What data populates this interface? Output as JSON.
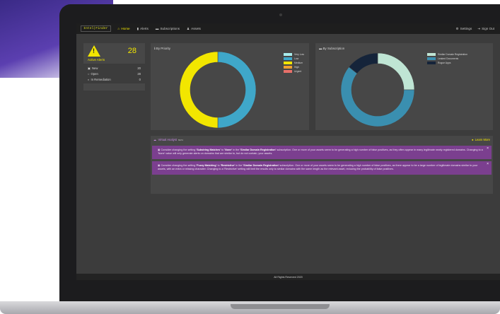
{
  "navbar": {
    "logo": "Intel|Finder",
    "items": [
      {
        "label": "Home",
        "icon": "home-icon",
        "glyph": "⌂",
        "active": true
      },
      {
        "label": "Alerts",
        "icon": "file-icon",
        "glyph": "▮"
      },
      {
        "label": "Subscriptions",
        "icon": "folder-icon",
        "glyph": "▬"
      },
      {
        "label": "Assets",
        "icon": "users-icon",
        "glyph": "♟"
      }
    ],
    "settings_label": "Settings",
    "signout_label": "Sign Out"
  },
  "alerts": {
    "count": "28",
    "title": "Active Alerts",
    "rows": [
      {
        "label": "New",
        "value": "20",
        "icon": "new-icon"
      },
      {
        "label": "Open",
        "value": "28",
        "icon": "open-icon"
      },
      {
        "label": "In Remediation",
        "value": "0",
        "icon": "remediation-icon"
      }
    ]
  },
  "priority_chart": {
    "title": "By Priority",
    "legend": [
      {
        "label": "Very Low",
        "color": "#a8ecec"
      },
      {
        "label": "Low",
        "color": "#3fa7c9"
      },
      {
        "label": "Medium",
        "color": "#f2e600"
      },
      {
        "label": "High",
        "color": "#f0a030"
      },
      {
        "label": "Urgent",
        "color": "#e8706a"
      }
    ]
  },
  "subscription_chart": {
    "title": "By Subscription",
    "legend": [
      {
        "label": "Similar Domain Registration",
        "color": "#bfe5d4"
      },
      {
        "label": "Leaked Documents",
        "color": "#3a8fb0"
      },
      {
        "label": "Rogue Apps",
        "color": "#15243a"
      }
    ]
  },
  "chart_data": [
    {
      "type": "pie",
      "title": "By Priority",
      "categories": [
        "Very Low",
        "Low",
        "Medium",
        "High",
        "Urgent"
      ],
      "values": [
        0,
        14,
        14,
        0,
        0
      ],
      "colors": [
        "#a8ecec",
        "#3fa7c9",
        "#f2e600",
        "#f0a030",
        "#e8706a"
      ]
    },
    {
      "type": "pie",
      "title": "By Subscription",
      "categories": [
        "Similar Domain Registration",
        "Leaked Documents",
        "Rogue Apps"
      ],
      "values": [
        7,
        17,
        4
      ],
      "colors": [
        "#bfe5d4",
        "#3a8fb0",
        "#15243a"
      ]
    }
  ],
  "ai": {
    "title": "Virtual Analyst",
    "beta": "BETA",
    "learn_more": "Learn More",
    "messages": [
      {
        "p1": "Consider changing the setting ",
        "b1": "'Substring Matches'",
        "p2": " to ",
        "b2": "'None'",
        "p3": " in the ",
        "b3": "'Similar Domain Registration'",
        "p4": " subscription. One or more of your assets seem to be generating a high number of false positives, as they often appear in many legitimate newly registered domains. Changing to a 'None' value will only generate alerts on domains that are similar to, but do not contain, your assets."
      },
      {
        "p1": "Consider changing the setting ",
        "b1": "'Fuzzy Matching'",
        "p2": " to ",
        "b2": "'Restrictive'",
        "p3": " in the ",
        "b3": "'Similar Domain Registration'",
        "p4": " subscription. One or more of your assets seem to be generating a high number of false positives, as there appear to be a large number of legitimate domains similar to your assets, with an extra or missing character. Changing to a 'Restrictive' setting will limit the results only to similar domains with the same length as the relevant asset, reducing the probability of false positives."
      }
    ]
  },
  "footer": {
    "text": "All Rights Reserved 2020"
  }
}
